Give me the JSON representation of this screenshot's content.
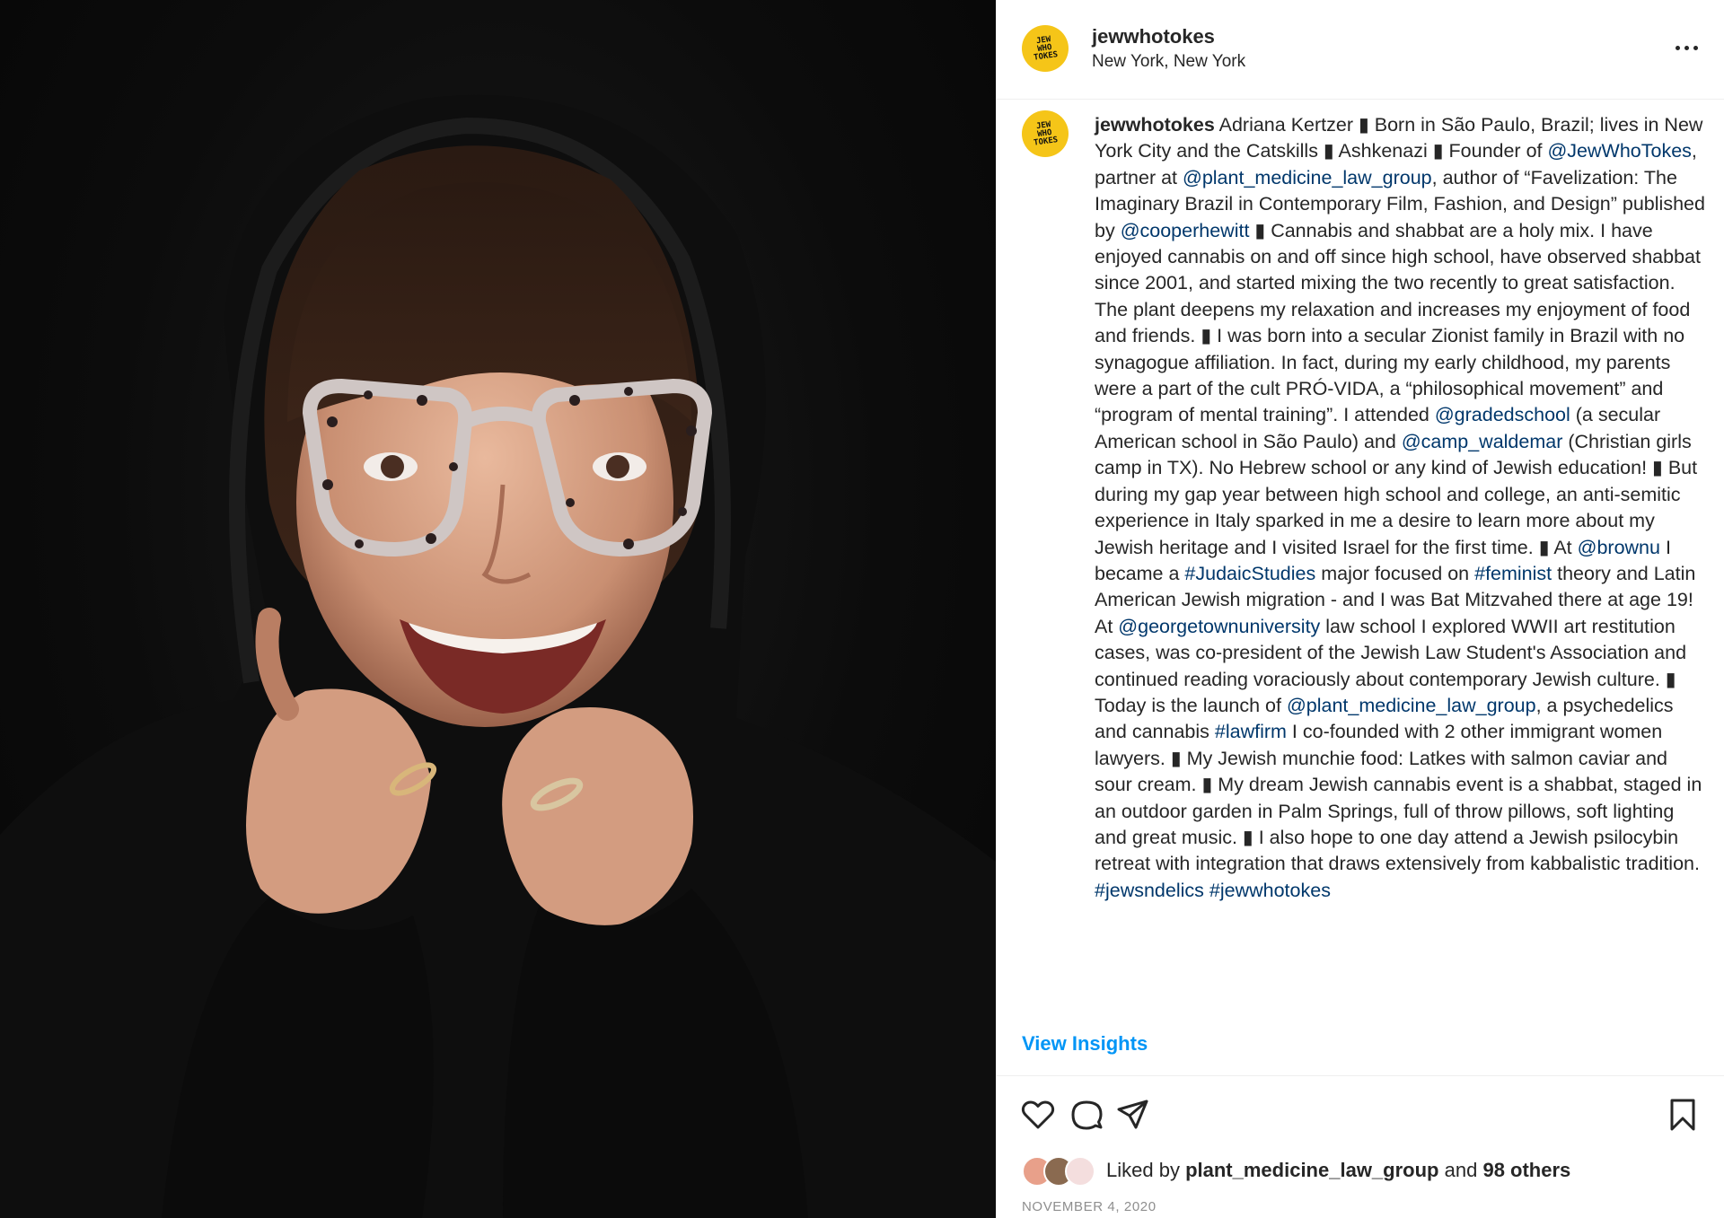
{
  "post": {
    "username": "jewwhotokes",
    "location": "New York, New York",
    "avatar_logo_lines": [
      "JEW",
      "WHO",
      "TOKES"
    ],
    "avatar_color": "#f5c518",
    "more_icon": "ellipsis-horizontal-icon"
  },
  "caption": {
    "segments": [
      {
        "t": "Adriana Kertzer ▮ Born in São Paulo, Brazil; lives in New York City and the Catskills ▮ Ashkenazi ▮ Founder of "
      },
      {
        "t": "@JewWhoTokes",
        "link": true
      },
      {
        "t": ", partner at "
      },
      {
        "t": "@plant_medicine_law_group",
        "link": true
      },
      {
        "t": ", author of “Favelization: The Imaginary Brazil in Contemporary Film, Fashion, and Design” published by "
      },
      {
        "t": "@cooperhewitt",
        "link": true
      },
      {
        "t": " ▮ Cannabis and shabbat are a holy mix. I have enjoyed cannabis on and off since high school, have observed shabbat since 2001, and started mixing the two recently to great satisfaction. The plant deepens my relaxation and increases my enjoyment of food and friends. ▮ I was born into a secular Zionist family in Brazil with no synagogue affiliation. In fact, during my early childhood, my parents were a part of the cult PRÓ-VIDA, a “philosophical movement” and “program of mental training”. I attended "
      },
      {
        "t": "@gradedschool",
        "link": true
      },
      {
        "t": " (a secular American school in São Paulo) and "
      },
      {
        "t": "@camp_waldemar",
        "link": true
      },
      {
        "t": " (Christian girls camp in TX). No Hebrew school or any kind of Jewish education! ▮ But during my gap year between high school and college, an anti-semitic experience in Italy sparked in me a desire to learn more about my Jewish heritage and I visited Israel for the first time. ▮ At "
      },
      {
        "t": "@brownu",
        "link": true
      },
      {
        "t": " I became a "
      },
      {
        "t": "#JudaicStudies",
        "link": true
      },
      {
        "t": " major focused on "
      },
      {
        "t": "#feminist",
        "link": true
      },
      {
        "t": " theory and Latin American Jewish migration - and I was Bat Mitzvahed there at age 19! At "
      },
      {
        "t": "@georgetownuniversity",
        "link": true
      },
      {
        "t": " law school I explored WWII art restitution cases, was co-president of the Jewish Law Student's Association and continued reading voraciously about contemporary Jewish culture. ▮ Today is the launch of "
      },
      {
        "t": "@plant_medicine_law_group",
        "link": true
      },
      {
        "t": ", a psychedelics and cannabis "
      },
      {
        "t": "#lawfirm",
        "link": true
      },
      {
        "t": " I co-founded with 2 other immigrant women lawyers. ▮ My Jewish munchie food: Latkes with salmon caviar and sour cream. ▮ My dream Jewish cannabis event is a shabbat, staged in an outdoor garden in Palm Springs, full of throw pillows, soft lighting and great music. ▮ I also hope to one day attend a Jewish psilocybin retreat with integration that draws extensively from kabbalistic tradition. "
      },
      {
        "t": "#jewsndelics",
        "link": true
      },
      {
        "t": " "
      },
      {
        "t": "#jewwhotokes",
        "link": true
      }
    ]
  },
  "insights_label": "View Insights",
  "actions": {
    "like_icon": "heart-icon",
    "comment_icon": "comment-icon",
    "share_icon": "share-icon",
    "save_icon": "bookmark-icon"
  },
  "likes": {
    "prefix": "Liked by",
    "user": "plant_medicine_law_group",
    "middle": "and",
    "others": "98 others"
  },
  "date": "NOVEMBER 4, 2020",
  "colors": {
    "link": "#00376b",
    "insights": "#0095f6",
    "text": "#262626",
    "muted": "#8e8e8e"
  }
}
